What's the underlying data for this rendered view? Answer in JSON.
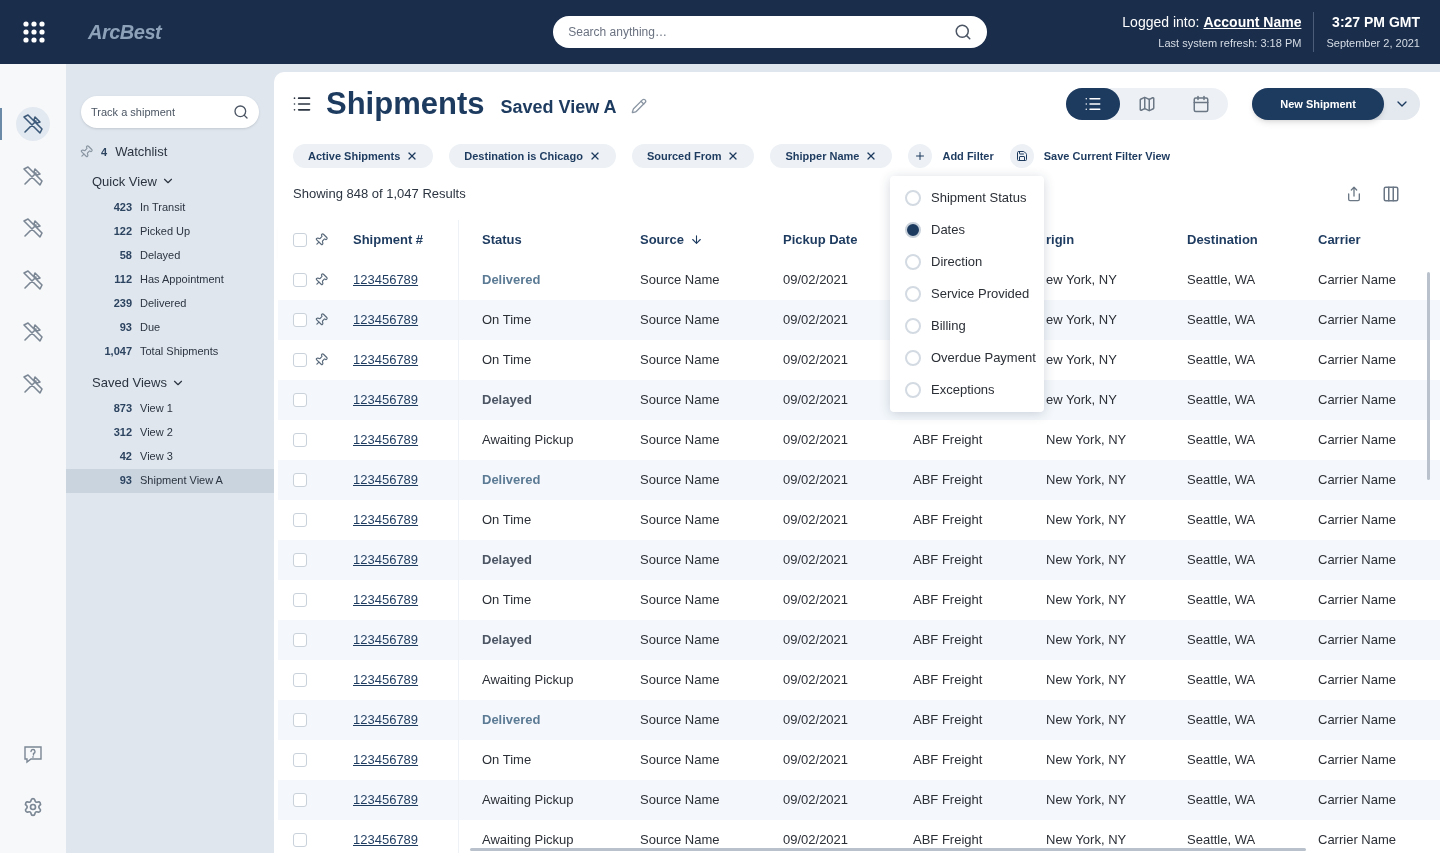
{
  "header": {
    "logo": "ArcBest",
    "search_placeholder": "Search anything…",
    "logged_label": "Logged into:",
    "account": "Account Name",
    "refresh": "Last system refresh: 3:18 PM",
    "time": "3:27 PM GMT",
    "date": "September 2, 2021"
  },
  "rail": [
    {
      "selected": true
    },
    {
      "selected": false
    },
    {
      "selected": false
    },
    {
      "selected": false
    },
    {
      "selected": false
    },
    {
      "selected": false
    }
  ],
  "sidebar": {
    "track_placeholder": "Track a shipment",
    "watchlist": {
      "count": "4",
      "label": "Watchlist"
    },
    "sections": [
      {
        "title": "Quick View",
        "expanded": true,
        "items": [
          {
            "count": "423",
            "label": "In Transit",
            "selected": false
          },
          {
            "count": "122",
            "label": "Picked Up",
            "selected": false
          },
          {
            "count": "58",
            "label": "Delayed",
            "selected": false
          },
          {
            "count": "112",
            "label": "Has Appointment",
            "selected": false
          },
          {
            "count": "239",
            "label": "Delivered",
            "selected": false
          },
          {
            "count": "93",
            "label": "Due",
            "selected": false
          },
          {
            "count": "1,047",
            "label": "Total Shipments",
            "selected": false
          }
        ]
      },
      {
        "title": "Saved Views",
        "expanded": true,
        "items": [
          {
            "count": "873",
            "label": "View 1",
            "selected": false
          },
          {
            "count": "312",
            "label": "View 2",
            "selected": false
          },
          {
            "count": "42",
            "label": "View 3",
            "selected": false
          },
          {
            "count": "93",
            "label": "Shipment View A",
            "selected": true
          }
        ]
      }
    ]
  },
  "page": {
    "title": "Shipments",
    "subtitle": "Saved View A",
    "views": [
      {
        "kind": "list",
        "selected": true
      },
      {
        "kind": "map",
        "selected": false
      },
      {
        "kind": "calendar",
        "selected": false
      }
    ],
    "new_button": "New Shipment"
  },
  "filters": [
    {
      "label": "Active Shipments"
    },
    {
      "label": "Destination is Chicago"
    },
    {
      "label": "Sourced From"
    },
    {
      "label": "Shipper Name"
    }
  ],
  "add_filter": "Add Filter",
  "save_view": "Save Current Filter View",
  "results": "Showing 848 of 1,047 Results",
  "dropdown": [
    {
      "label": "Shipment Status",
      "selected": false
    },
    {
      "label": "Dates",
      "selected": true
    },
    {
      "label": "Direction",
      "selected": false
    },
    {
      "label": "Service Provided",
      "selected": false
    },
    {
      "label": "Billing",
      "selected": false
    },
    {
      "label": "Overdue Payment",
      "selected": false
    },
    {
      "label": "Exceptions",
      "selected": false
    }
  ],
  "table": {
    "header_checked": false,
    "columns": [
      {
        "label": "Shipment #",
        "sorted": false
      },
      {
        "label": "Status",
        "sorted": false
      },
      {
        "label": "Source",
        "sorted": true
      },
      {
        "label": "Pickup Date",
        "sorted": false
      },
      {},
      {
        "label": "rigin",
        "sorted": false
      },
      {
        "label": "Destination",
        "sorted": false
      },
      {
        "label": "Carrier",
        "sorted": false
      }
    ],
    "rows": [
      {
        "checked": false,
        "pinned": true,
        "shipment": "123456789",
        "status": "Delivered",
        "kind": "delivered",
        "source": "Source Name",
        "pickup": "09/02/2021",
        "origin": "ew York, NY",
        "destination": "Seattle, WA",
        "carrier": "Carrier Name"
      },
      {
        "checked": false,
        "pinned": true,
        "shipment": "123456789",
        "status": "On Time",
        "kind": "normal",
        "source": "Source Name",
        "pickup": "09/02/2021",
        "origin": "ew York, NY",
        "destination": "Seattle, WA",
        "carrier": "Carrier Name"
      },
      {
        "checked": false,
        "pinned": true,
        "shipment": "123456789",
        "status": "On Time",
        "kind": "normal",
        "source": "Source Name",
        "pickup": "09/02/2021",
        "origin": "ew York, NY",
        "destination": "Seattle, WA",
        "carrier": "Carrier Name"
      },
      {
        "checked": false,
        "pinned": false,
        "shipment": "123456789",
        "status": "Delayed",
        "kind": "delayed",
        "source": "Source Name",
        "pickup": "09/02/2021",
        "origin": "ew York, NY",
        "destination": "Seattle, WA",
        "carrier": "Carrier Name"
      },
      {
        "checked": false,
        "pinned": false,
        "shipment": "123456789",
        "status": "Awaiting Pickup",
        "kind": "normal",
        "source": "Source Name",
        "pickup": "09/02/2021",
        "column_5": "ABF Freight",
        "origin": "New York, NY",
        "destination": "Seattle, WA",
        "carrier": "Carrier Name"
      },
      {
        "checked": false,
        "pinned": false,
        "shipment": "123456789",
        "status": "Delivered",
        "kind": "delivered",
        "source": "Source Name",
        "pickup": "09/02/2021",
        "column_5": "ABF Freight",
        "origin": "New York, NY",
        "destination": "Seattle, WA",
        "carrier": "Carrier Name"
      },
      {
        "checked": false,
        "pinned": false,
        "shipment": "123456789",
        "status": "On Time",
        "kind": "normal",
        "source": "Source Name",
        "pickup": "09/02/2021",
        "column_5": "ABF Freight",
        "origin": "New York, NY",
        "destination": "Seattle, WA",
        "carrier": "Carrier Name"
      },
      {
        "checked": false,
        "pinned": false,
        "shipment": "123456789",
        "status": "Delayed",
        "kind": "delayed",
        "source": "Source Name",
        "pickup": "09/02/2021",
        "column_5": "ABF Freight",
        "origin": "New York, NY",
        "destination": "Seattle, WA",
        "carrier": "Carrier Name"
      },
      {
        "checked": false,
        "pinned": false,
        "shipment": "123456789",
        "status": "On Time",
        "kind": "normal",
        "source": "Source Name",
        "pickup": "09/02/2021",
        "column_5": "ABF Freight",
        "origin": "New York, NY",
        "destination": "Seattle, WA",
        "carrier": "Carrier Name"
      },
      {
        "checked": false,
        "pinned": false,
        "shipment": "123456789",
        "status": "Delayed",
        "kind": "delayed",
        "source": "Source Name",
        "pickup": "09/02/2021",
        "column_5": "ABF Freight",
        "origin": "New York, NY",
        "destination": "Seattle, WA",
        "carrier": "Carrier Name"
      },
      {
        "checked": false,
        "pinned": false,
        "shipment": "123456789",
        "status": "Awaiting Pickup",
        "kind": "normal",
        "source": "Source Name",
        "pickup": "09/02/2021",
        "column_5": "ABF Freight",
        "origin": "New York, NY",
        "destination": "Seattle, WA",
        "carrier": "Carrier Name"
      },
      {
        "checked": false,
        "pinned": false,
        "shipment": "123456789",
        "status": "Delivered",
        "kind": "delivered",
        "source": "Source Name",
        "pickup": "09/02/2021",
        "column_5": "ABF Freight",
        "origin": "New York, NY",
        "destination": "Seattle, WA",
        "carrier": "Carrier Name"
      },
      {
        "checked": false,
        "pinned": false,
        "shipment": "123456789",
        "status": "On Time",
        "kind": "normal",
        "source": "Source Name",
        "pickup": "09/02/2021",
        "column_5": "ABF Freight",
        "origin": "New York, NY",
        "destination": "Seattle, WA",
        "carrier": "Carrier Name"
      },
      {
        "checked": false,
        "pinned": false,
        "shipment": "123456789",
        "status": "Awaiting Pickup",
        "kind": "normal",
        "source": "Source Name",
        "pickup": "09/02/2021",
        "column_5": "ABF Freight",
        "origin": "New York, NY",
        "destination": "Seattle, WA",
        "carrier": "Carrier Name"
      },
      {
        "checked": false,
        "pinned": false,
        "shipment": "123456789",
        "status": "Awaiting Pickup",
        "kind": "normal",
        "source": "Source Name",
        "pickup": "09/02/2021",
        "column_5": "ABF Freight",
        "origin": "New York, NY",
        "destination": "Seattle, WA",
        "carrier": "Carrier Name"
      }
    ]
  }
}
